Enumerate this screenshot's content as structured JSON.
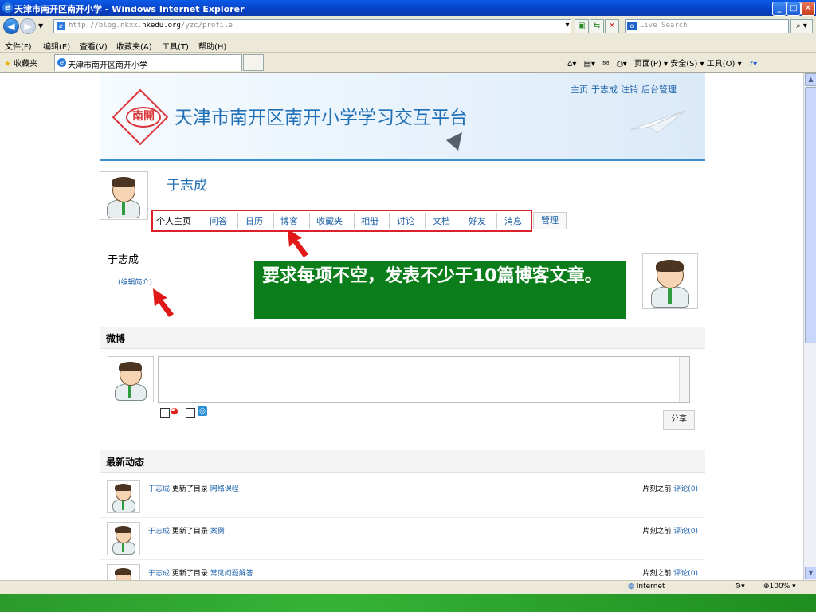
{
  "window": {
    "title": "天津市南开区南开小学 - Windows Internet Explorer",
    "controls": [
      "_",
      "□",
      "✕"
    ]
  },
  "addressbar": {
    "url_prefix": "http://blog.nkxx.",
    "url_host": "nkedu.org",
    "url_path": "/yzc/profile",
    "search_placeholder": "Live Search"
  },
  "menubar": {
    "items": [
      "文件(F)",
      "编辑(E)",
      "查看(V)",
      "收藏夹(A)",
      "工具(T)",
      "帮助(H)"
    ]
  },
  "tabbar": {
    "favorites_label": "收藏夹",
    "tab_title": "天津市南开区南开小学",
    "tools": "页面(P) ▾  安全(S) ▾  工具(O) ▾"
  },
  "site": {
    "logo_text": "南開",
    "title": "天津市南开区南开小学学习交互平台",
    "top_links": [
      "主页",
      "于志成",
      "注销",
      "后台管理"
    ]
  },
  "profile": {
    "user_name": "于志成",
    "nav_tabs": [
      "个人主页",
      "问答",
      "日历",
      "博客",
      "收藏夹",
      "相册",
      "讨论",
      "文档",
      "好友",
      "消息"
    ],
    "manage_tab": "管理",
    "display_name": "于志成",
    "edit_intro": "(编辑简介)"
  },
  "annotation": {
    "text": "要求每项不空，发表不少于10篇博客文章。",
    "colors": {
      "box": "#0b7d1b",
      "arrow": "#e01818",
      "nav_outline": "#d9222b"
    }
  },
  "weibo": {
    "heading": "微博",
    "share_label": "分享"
  },
  "feed": {
    "heading": "最新动态",
    "items": [
      {
        "user": "于志成",
        "action": "更新了目录",
        "target": "网络课程",
        "time": "片刻之前",
        "comment": "评论(0)"
      },
      {
        "user": "于志成",
        "action": "更新了目录",
        "target": "案例",
        "time": "片刻之前",
        "comment": "评论(0)"
      },
      {
        "user": "于志成",
        "action": "更新了目录",
        "target": "常见问题解答",
        "time": "片刻之前",
        "comment": "评论(0)"
      }
    ]
  },
  "statusbar": {
    "zone": "Internet",
    "zoom": "100%"
  }
}
